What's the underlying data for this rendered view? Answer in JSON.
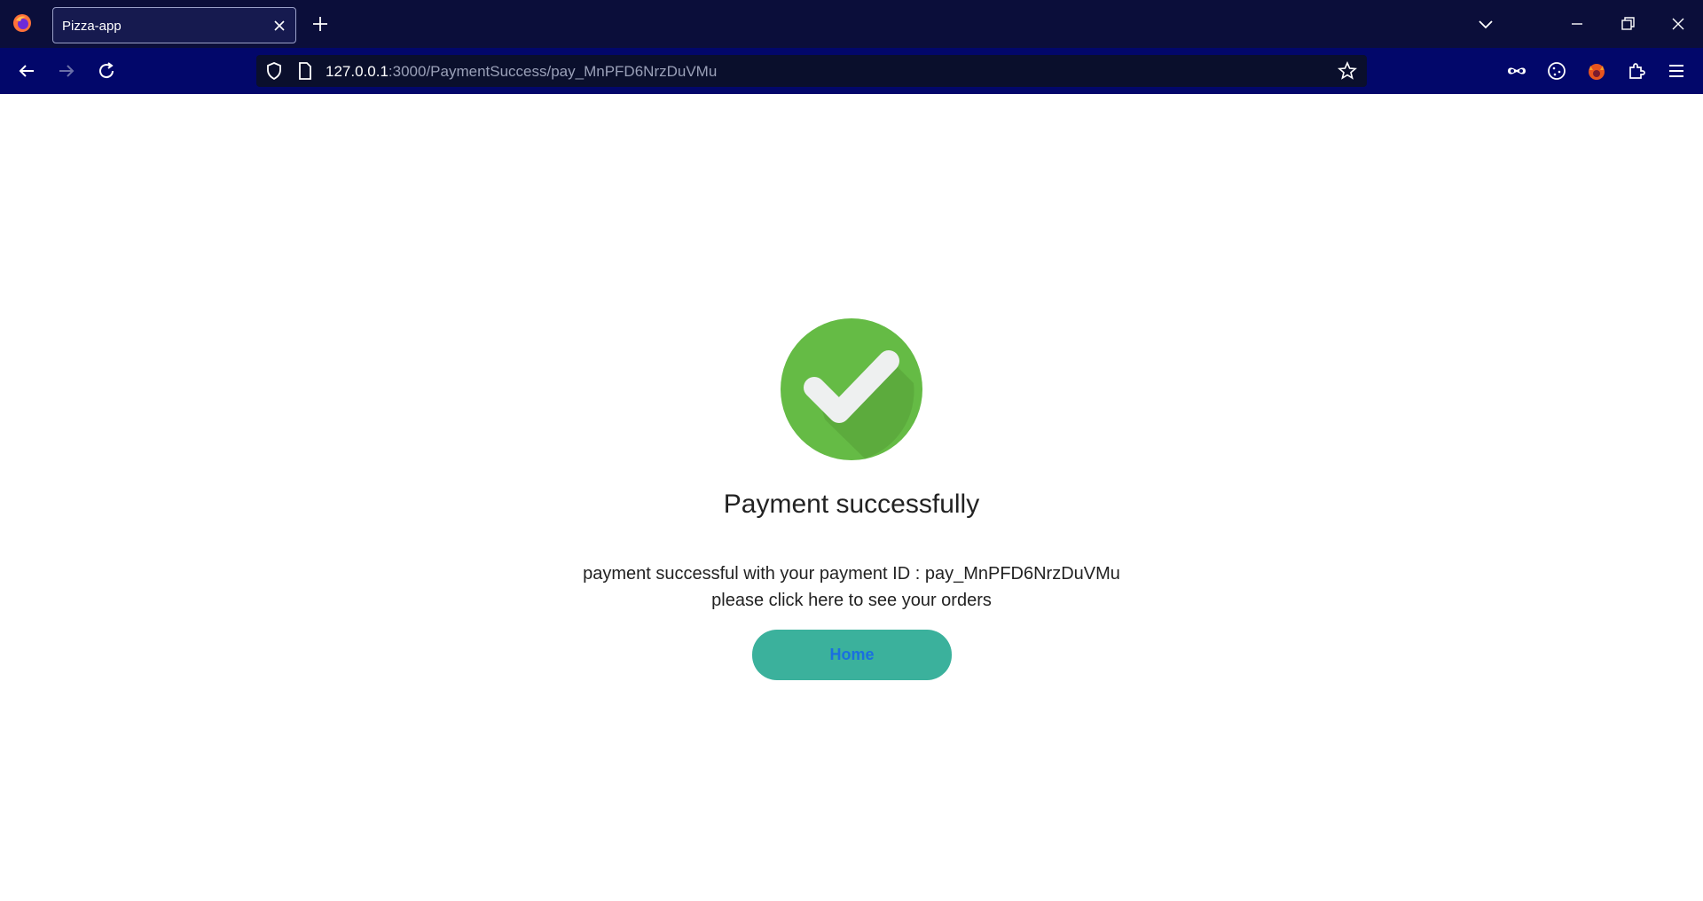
{
  "browser": {
    "tab_title": "Pizza-app",
    "url_host": "127.0.0.1",
    "url_rest": ":3000/PaymentSuccess/pay_MnPFD6NrzDuVMu",
    "icons": [
      "firefox-logo",
      "close-icon",
      "plus-icon",
      "chevron-down-icon",
      "minimize-icon",
      "restore-icon",
      "window-close-icon",
      "back-arrow-icon",
      "forward-arrow-icon",
      "reload-icon",
      "shield-icon",
      "page-icon",
      "star-icon",
      "mask-icon",
      "cookie-icon",
      "fox-extension-icon",
      "puzzle-icon",
      "hamburger-menu-icon"
    ]
  },
  "page": {
    "title": "Payment successfully",
    "message_line1": "payment successful with your payment ID : pay_MnPFD6NrzDuVMu",
    "message_line2": "please click here to see your orders",
    "home_button": "Home",
    "accent_colors": {
      "check_green": "#65bb45",
      "button_teal": "#3bb19c",
      "button_text": "#1a6fe0"
    }
  }
}
